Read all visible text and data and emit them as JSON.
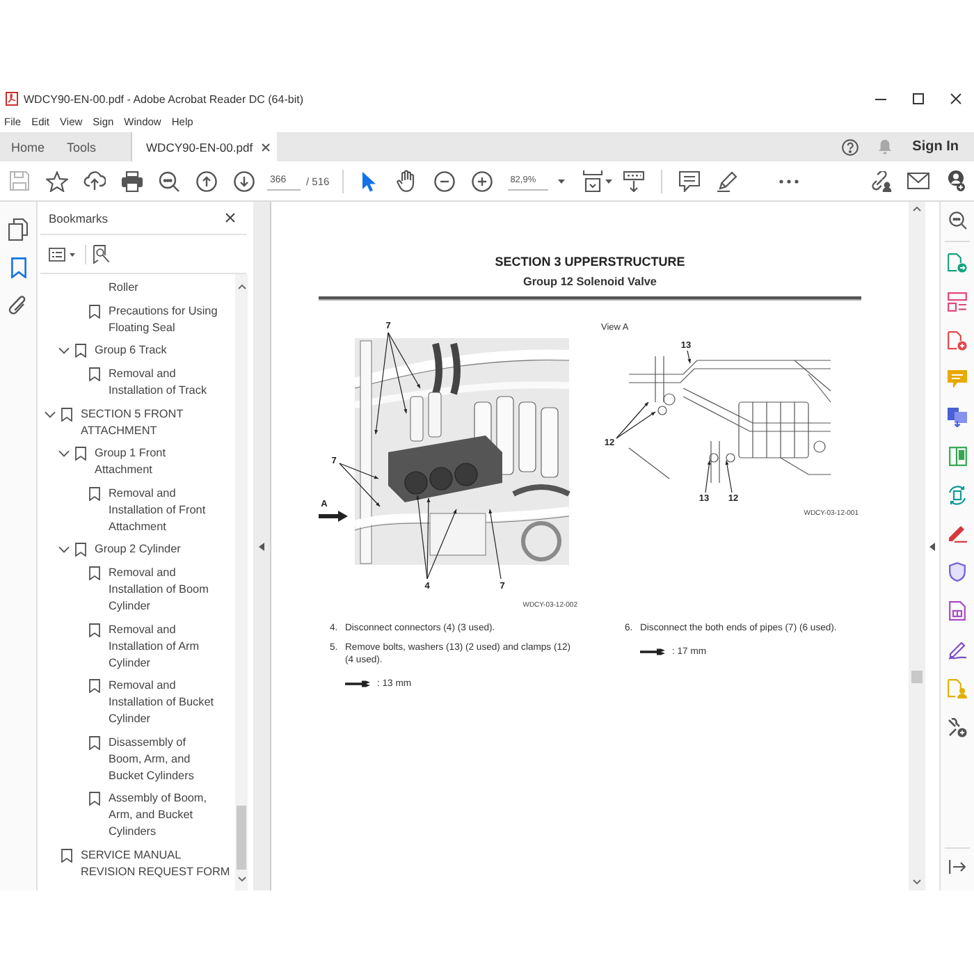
{
  "window": {
    "title": "WDCY90-EN-00.pdf - Adobe Acrobat Reader DC (64-bit)"
  },
  "menu": [
    "File",
    "Edit",
    "View",
    "Sign",
    "Window",
    "Help"
  ],
  "tabs": [
    {
      "label": "Home",
      "kind": "view",
      "selected": false
    },
    {
      "label": "Tools",
      "kind": "view",
      "selected": false
    },
    {
      "label": "WDCY90-EN-00.pdf",
      "kind": "document",
      "selected": true
    }
  ],
  "account": {
    "sign_in": "Sign In"
  },
  "toolbar": {
    "save_disabled": true,
    "page": "366",
    "page_total": "/ 516",
    "tools": [
      {
        "kind": "select",
        "selected": true
      },
      {
        "kind": "hand",
        "selected": false
      }
    ],
    "zoom": "82,9%"
  },
  "nav_panel": [
    {
      "kind": "pages",
      "selected": false
    },
    {
      "kind": "bookmarks",
      "selected": true
    },
    {
      "kind": "attachments",
      "selected": false
    }
  ],
  "bookmarks": {
    "title": "Bookmarks",
    "tree": [
      {
        "children": [
          {
            "children": [
              {
                "label": "Roller",
                "kind": "continuation"
              },
              {
                "label": "Precautions for Using Floating Seal",
                "kind": "bookmark"
              }
            ]
          },
          {
            "label": "Group 6 Track",
            "kind": "bookmark",
            "expanded": true,
            "children": [
              {
                "label": "Removal and Installation of Track",
                "kind": "bookmark"
              }
            ]
          }
        ]
      },
      {
        "label": "SECTION 5 FRONT ATTACHMENT",
        "kind": "bookmark",
        "expanded": true,
        "children": [
          {
            "label": "Group 1 Front Attachment",
            "kind": "bookmark",
            "expanded": true,
            "children": [
              {
                "label": "Removal and Installation of Front Attachment",
                "kind": "bookmark"
              }
            ]
          },
          {
            "label": "Group 2 Cylinder",
            "kind": "bookmark",
            "expanded": true,
            "children": [
              {
                "label": "Removal and Installation of Boom Cylinder",
                "kind": "bookmark"
              },
              {
                "label": "Removal and Installation of Arm Cylinder",
                "kind": "bookmark"
              },
              {
                "label": "Removal and Installation of Bucket Cylinder",
                "kind": "bookmark"
              },
              {
                "label": "Disassembly of Boom, Arm, and Bucket Cylinders",
                "kind": "bookmark"
              },
              {
                "label": "Assembly of Boom, Arm, and Bucket Cylinders",
                "kind": "bookmark"
              }
            ]
          }
        ]
      },
      {
        "label": "SERVICE MANUAL REVISION REQUEST FORM",
        "kind": "bookmark"
      }
    ]
  },
  "page": {
    "section": "SECTION 3 UPPERSTRUCTURE",
    "group": "Group 12 Solenoid Valve",
    "figures": [
      {
        "callouts": [
          "7",
          "7",
          "A",
          "4",
          "7"
        ],
        "caption": "WDCY-03-12-002"
      },
      {
        "title": "View A",
        "callouts": [
          "13",
          "12",
          "13",
          "12"
        ],
        "caption": "WDCY-03-12-001"
      }
    ],
    "columns": [
      {
        "steps": [
          {
            "number": "4.",
            "text": "Disconnect connectors (4) (3 used)."
          },
          {
            "number": "5.",
            "text": "Remove bolts, washers (13) (2 used) and clamps (12) (4 used)."
          }
        ],
        "wrench_size": ": 13 mm"
      },
      {
        "steps": [
          {
            "number": "6.",
            "text": "Disconnect the both ends of pipes (7) (6 used)."
          }
        ],
        "wrench_size": ": 17 mm"
      }
    ]
  }
}
